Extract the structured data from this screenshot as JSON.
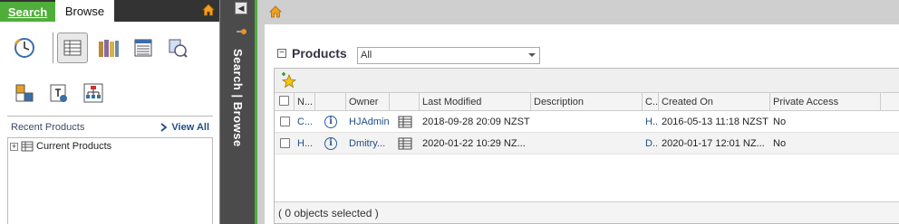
{
  "left_panel": {
    "tabs": {
      "search": "Search",
      "browse": "Browse"
    },
    "recent_title": "Recent Products",
    "view_all": "View All",
    "tree": [
      {
        "label": "Current Products"
      }
    ]
  },
  "strip": {
    "label": "Search | Browse"
  },
  "products": {
    "title": "Products",
    "filter_value": "All",
    "columns": [
      "N...",
      "Owner",
      "Last Modified",
      "Description",
      "C...",
      "Created On",
      "Private Access"
    ],
    "rows": [
      {
        "name": "C...",
        "owner": "HJAdmin",
        "last_modified": "2018-09-28 20:09 NZST",
        "description": "",
        "c": "H...",
        "created_on": "2016-05-13 11:18 NZST",
        "private_access": "No"
      },
      {
        "name": "H...",
        "owner": "Dmitry...",
        "last_modified": "2020-01-22 10:29 NZ...",
        "description": "",
        "c": "D...",
        "created_on": "2020-01-17 12:01 NZ...",
        "private_access": "No"
      }
    ],
    "status": "( 0 objects selected )"
  },
  "colors": {
    "accent_green": "#4fae3a",
    "dark_bar": "#333333",
    "link_blue": "#1f4f8a"
  }
}
